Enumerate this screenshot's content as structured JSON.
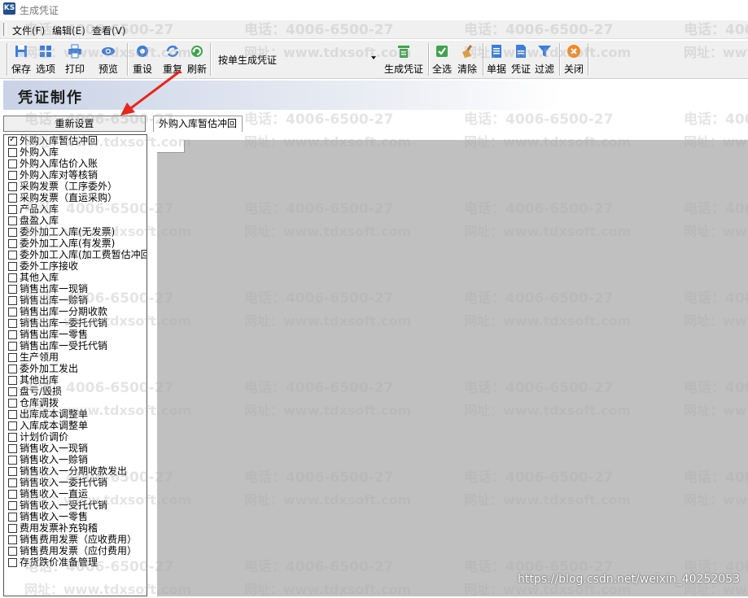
{
  "window": {
    "title": "生成凭证",
    "icon_text": "KS"
  },
  "menu": [
    "文件(F)",
    "编辑(E)",
    "查看(V)"
  ],
  "toolbar": {
    "buttons": [
      {
        "label": "保存",
        "icon": "save-icon"
      },
      {
        "label": "选项",
        "icon": "grid-options-icon"
      },
      {
        "label": "打印",
        "icon": "printer-icon"
      },
      {
        "label": "预览",
        "icon": "eye-preview-icon"
      },
      {
        "label": "重设",
        "icon": "gear-reset-icon"
      },
      {
        "label": "重复",
        "icon": "repeat-icon"
      },
      {
        "label": "刷新",
        "icon": "refresh-icon"
      },
      {
        "label": "生成凭证",
        "icon": "generate-voucher-icon"
      },
      {
        "label": "全选",
        "icon": "select-all-icon"
      },
      {
        "label": "清除",
        "icon": "broom-clear-icon"
      },
      {
        "label": "单据",
        "icon": "document-icon"
      },
      {
        "label": "凭证",
        "icon": "voucher-icon"
      },
      {
        "label": "过滤",
        "icon": "filter-icon"
      },
      {
        "label": "关闭",
        "icon": "close-icon"
      }
    ],
    "mode_select": "按单生成凭证"
  },
  "banner": {
    "title": "凭证制作"
  },
  "left_panel": {
    "reset_button": "重新设置",
    "items": [
      {
        "label": "外购入库暂估冲回",
        "checked": true
      },
      {
        "label": "外购入库",
        "checked": false
      },
      {
        "label": "外购入库估价入账",
        "checked": false
      },
      {
        "label": "外购入库对等核销",
        "checked": false
      },
      {
        "label": "采购发票（工序委外）",
        "checked": false
      },
      {
        "label": "采购发票（直运采购）",
        "checked": false
      },
      {
        "label": "产品入库",
        "checked": false
      },
      {
        "label": "盘盈入库",
        "checked": false
      },
      {
        "label": "委外加工入库(无发票)",
        "checked": false
      },
      {
        "label": "委外加工入库(有发票)",
        "checked": false
      },
      {
        "label": "委外加工入库(加工费暂估冲回",
        "checked": false
      },
      {
        "label": "委外工序接收",
        "checked": false
      },
      {
        "label": "其他入库",
        "checked": false
      },
      {
        "label": "销售出库一现销",
        "checked": false
      },
      {
        "label": "销售出库一赊销",
        "checked": false
      },
      {
        "label": "销售出库一分期收款",
        "checked": false
      },
      {
        "label": "销售出库一委托代销",
        "checked": false
      },
      {
        "label": "销售出库一零售",
        "checked": false
      },
      {
        "label": "销售出库一受托代销",
        "checked": false
      },
      {
        "label": "生产领用",
        "checked": false
      },
      {
        "label": "委外加工发出",
        "checked": false
      },
      {
        "label": "其他出库",
        "checked": false
      },
      {
        "label": "盘亏/毁损",
        "checked": false
      },
      {
        "label": "仓库调拨",
        "checked": false
      },
      {
        "label": "出库成本调整单",
        "checked": false
      },
      {
        "label": "入库成本调整单",
        "checked": false
      },
      {
        "label": "计划价调价",
        "checked": false
      },
      {
        "label": "销售收入一现销",
        "checked": false
      },
      {
        "label": "销售收入一赊销",
        "checked": false
      },
      {
        "label": "销售收入一分期收款发出",
        "checked": false
      },
      {
        "label": "销售收入一委托代销",
        "checked": false
      },
      {
        "label": "销售收入一直运",
        "checked": false
      },
      {
        "label": "销售收入一受托代销",
        "checked": false
      },
      {
        "label": "销售收入一零售",
        "checked": false
      },
      {
        "label": "费用发票补充钩稽",
        "checked": false
      },
      {
        "label": "销售费用发票（应收费用）",
        "checked": false
      },
      {
        "label": "销售费用发票（应付费用）",
        "checked": false
      },
      {
        "label": "存货跌价准备管理",
        "checked": false
      }
    ]
  },
  "tabs": [
    "外购入库暂估冲回"
  ],
  "watermark": {
    "phone": "电话：4006-6500-27",
    "site": "网址：www.tdxsoft.com"
  },
  "footer": "https://blog.csdn.net/weixin_40252053",
  "colors": {
    "content_bg": "#c0c0c0",
    "arrow": "#e8261c",
    "toolbar_bg": "#f0f0f0"
  }
}
